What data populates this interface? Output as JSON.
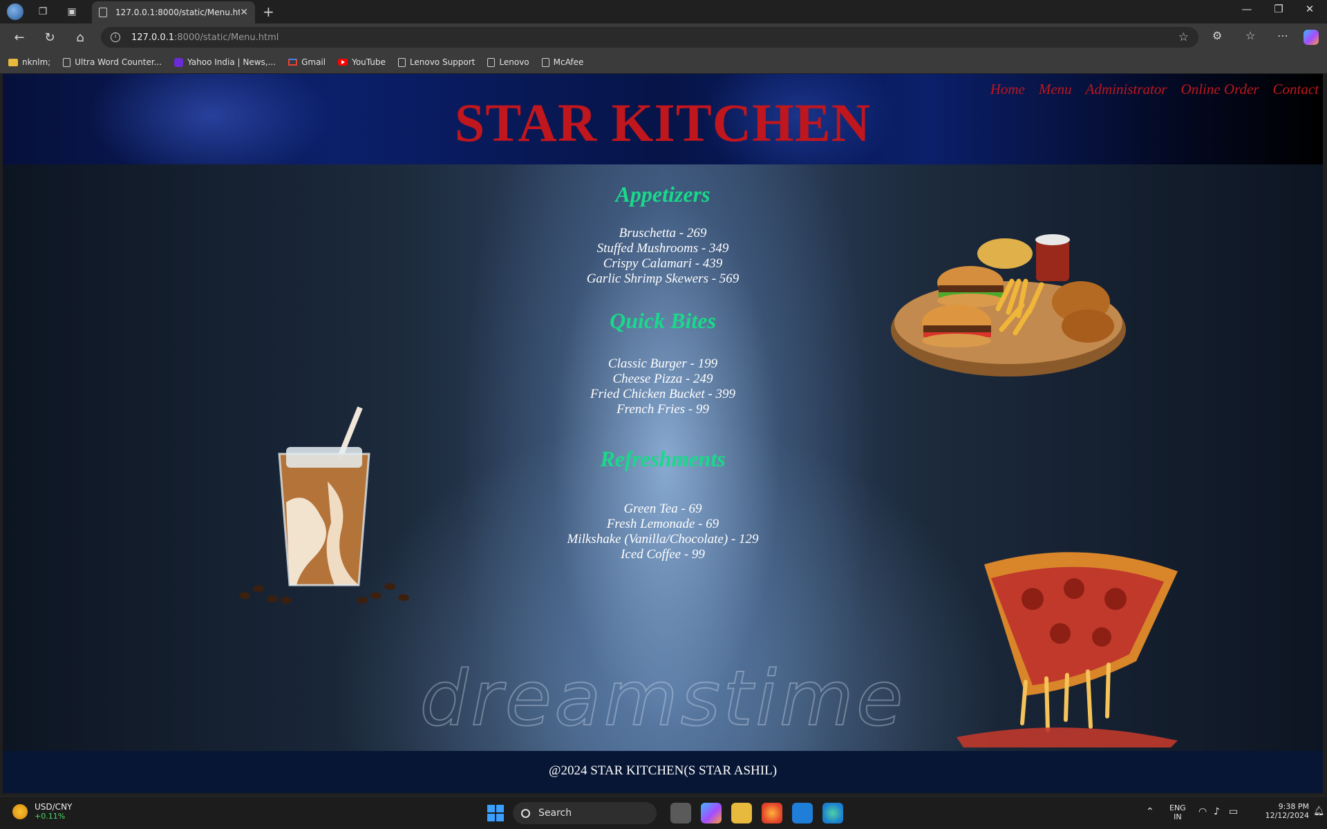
{
  "browser": {
    "tab_title": "127.0.0.1:8000/static/Menu.html",
    "url_host": "127.0.0.1",
    "url_path": ":8000/static/Menu.html",
    "bookmarks": [
      "nknlm;",
      "Ultra Word Counter...",
      "Yahoo India | News,...",
      "Gmail",
      "YouTube",
      "Lenovo Support",
      "Lenovo",
      "McAfee"
    ]
  },
  "site": {
    "title": "STAR KITCHEN",
    "nav": [
      "Home",
      "Menu",
      "Administrator",
      "Online Order",
      "Contact"
    ],
    "title_color": "#c0161e",
    "section_color": "#19d98a"
  },
  "menu": {
    "sections": [
      {
        "title": "Appetizers",
        "items": [
          "Bruschetta - 269",
          "Stuffed Mushrooms - 349",
          "Crispy Calamari - 439",
          "Garlic Shrimp Skewers - 569"
        ]
      },
      {
        "title": "Quick Bites",
        "items": [
          "Classic Burger - 199",
          "Cheese Pizza - 249",
          "Fried Chicken Bucket - 399",
          "French Fries - 99"
        ]
      },
      {
        "title": "Refreshments",
        "items": [
          "Green Tea - 69",
          "Fresh Lemonade - 69",
          "Milkshake (Vanilla/Chocolate) - 129",
          "Iced Coffee - 99"
        ]
      }
    ]
  },
  "watermark": "dreamstime",
  "footer": {
    "copyright": "@2024 STAR KITCHEN(S STAR ASHIL)"
  },
  "taskbar": {
    "widget_title": "USD/CNY",
    "widget_value": "+0.11%",
    "search_placeholder": "Search",
    "lang_top": "ENG",
    "lang_bottom": "IN",
    "time": "9:38 PM",
    "date": "12/12/2024"
  }
}
